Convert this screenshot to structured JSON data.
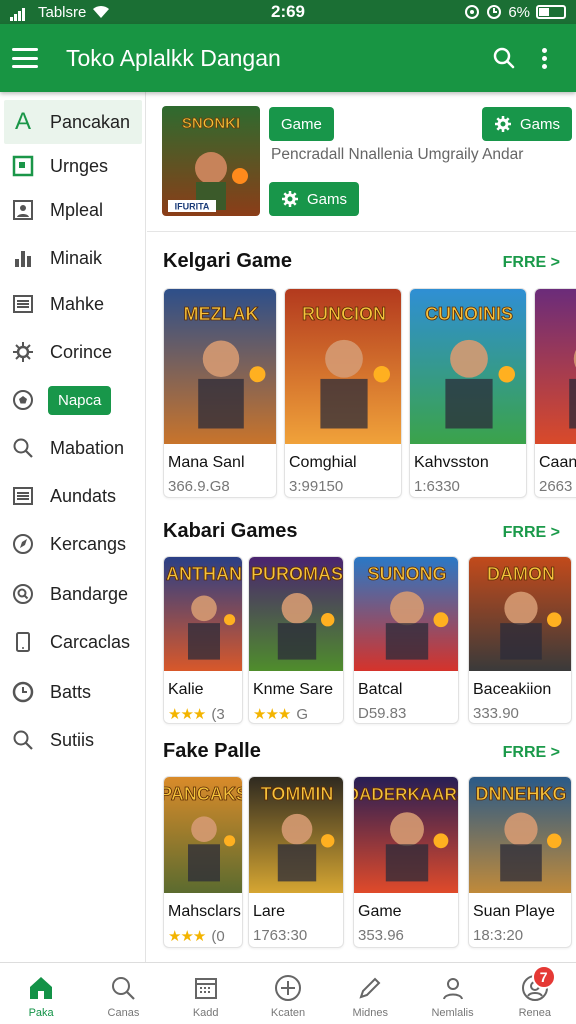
{
  "status_bar": {
    "carrier": "Tablsre",
    "time": "2:69",
    "battery": "6%"
  },
  "app_bar": {
    "title": "Toko Aplalkk Dangan"
  },
  "sidebar": {
    "items": [
      {
        "label": "Pancakan",
        "icon": "a-letter-icon",
        "active": true
      },
      {
        "label": "Urnges",
        "icon": "square-frame-icon"
      },
      {
        "label": "Mpleal",
        "icon": "portrait-icon"
      },
      {
        "label": "Minaik",
        "icon": "chart-bars-icon"
      },
      {
        "label": "Mahke",
        "icon": "list-box-icon"
      },
      {
        "label": "Corince",
        "icon": "gear-icon"
      },
      {
        "label": "Napca",
        "icon": "soccer-ball-icon",
        "pill": true
      },
      {
        "label": "Mabation",
        "icon": "search-icon"
      },
      {
        "label": "Aundats",
        "icon": "list-box-icon"
      },
      {
        "label": "Kercangs",
        "icon": "compass-icon"
      },
      {
        "label": "Bandarge",
        "icon": "search-circle-icon"
      },
      {
        "label": "Carcaclas",
        "icon": "tablet-icon"
      },
      {
        "label": "Batts",
        "icon": "clock-icon"
      },
      {
        "label": "Sutiis",
        "icon": "search-icon"
      }
    ]
  },
  "hero": {
    "art_title": "SNONKI",
    "art_badge": "IFURITA",
    "button1": "Game",
    "button2": "Gams",
    "button3": "Gams",
    "description": "Pencradall Nnallenia Umgraily Andar"
  },
  "sections": [
    {
      "title": "Kelgari Game",
      "more": "FRRE >",
      "items": [
        {
          "name": "Mana Sanl",
          "meta": "366.9.G8",
          "art": "MEZLAK",
          "c1": "#2d4f8a",
          "c2": "#c8742b"
        },
        {
          "name": "Comghial",
          "meta": "3:99150",
          "art": "RUNCION",
          "c1": "#b33a1e",
          "c2": "#f0a23a"
        },
        {
          "name": "Kahvsston",
          "meta": "1:6330",
          "art": "CUNOINIS",
          "c1": "#2f8fd4",
          "c2": "#3ba34a"
        },
        {
          "name": "Caan",
          "meta": "2663",
          "art": "J",
          "c1": "#6b2c7a",
          "c2": "#d94a2a"
        }
      ]
    },
    {
      "title": "Kabari Games",
      "more": "FRRE >",
      "items": [
        {
          "name": "Kalie",
          "meta": "(3",
          "stars": "★★★",
          "art": "ANTHAN",
          "c1": "#2a3f86",
          "c2": "#d8582a"
        },
        {
          "name": "Knme Sare",
          "meta": "G",
          "stars": "★★★",
          "art": "PUROMAS",
          "c1": "#4a2470",
          "c2": "#4f8d2c"
        },
        {
          "name": "Batcal",
          "meta": "D59.83",
          "art": "SUNONG",
          "c1": "#2a78c6",
          "c2": "#d5332b"
        },
        {
          "name": "Baceakiion",
          "meta": "333.90",
          "art": "DAMON",
          "c1": "#c24a1b",
          "c2": "#3a3a3a"
        }
      ]
    },
    {
      "title": "Fake Palle",
      "more": "FRRE >",
      "items": [
        {
          "name": "Mahsclars",
          "meta": "(0",
          "stars": "★★★",
          "art": "PANCAKS",
          "c1": "#d98b2a",
          "c2": "#5b6b2f"
        },
        {
          "name": "Lare",
          "meta": "1763:30",
          "art": "TOMMIN",
          "c1": "#2f2a20",
          "c2": "#d6a632"
        },
        {
          "name": "Game",
          "meta": "353.96",
          "art": "OADERKAARS",
          "c1": "#271e55",
          "c2": "#e04a2a"
        },
        {
          "name": "Suan Playe",
          "meta": "18:3:20",
          "art": "DNNEHKG",
          "c1": "#2a5a88",
          "c2": "#c08a3a"
        }
      ]
    }
  ],
  "bottom_nav": {
    "items": [
      {
        "label": "Paka",
        "icon": "home-icon",
        "active": true
      },
      {
        "label": "Canas",
        "icon": "search-icon"
      },
      {
        "label": "Kadd",
        "icon": "calendar-icon"
      },
      {
        "label": "Kcaten",
        "icon": "plus-circle-icon"
      },
      {
        "label": "Midnes",
        "icon": "pencil-icon"
      },
      {
        "label": "Nemlalis",
        "icon": "person-icon"
      },
      {
        "label": "Renea",
        "icon": "account-icon",
        "badge": "7"
      }
    ]
  },
  "colors": {
    "primary": "#189543",
    "dark": "#1b6f34",
    "accent_text": "#1b9a4a",
    "star": "#f3b400"
  }
}
